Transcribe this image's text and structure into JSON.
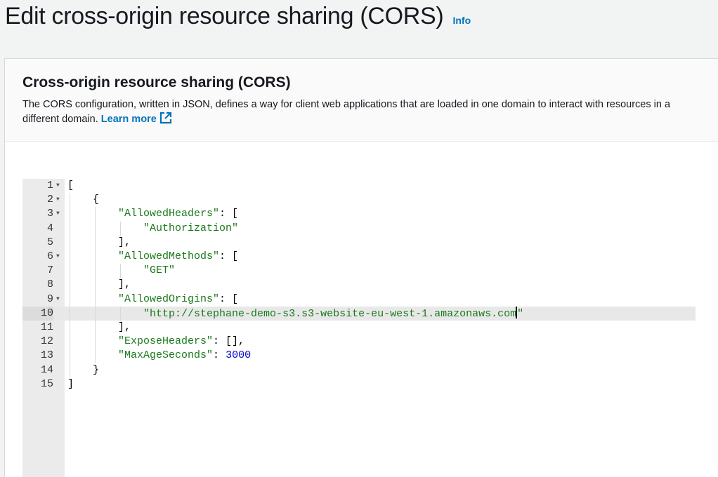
{
  "page": {
    "title": "Edit cross-origin resource sharing (CORS)",
    "info_label": "Info"
  },
  "panel": {
    "title": "Cross-origin resource sharing (CORS)",
    "description": "The CORS configuration, written in JSON, defines a way for client web applications that are loaded in one domain to interact with resources in a different domain.",
    "learn_more": "Learn more"
  },
  "editor": {
    "active_line": 10,
    "line_numbers": [
      "1",
      "2",
      "3",
      "4",
      "5",
      "6",
      "7",
      "8",
      "9",
      "10",
      "11",
      "12",
      "13",
      "14",
      "15"
    ],
    "lines": [
      {
        "indent": "",
        "tokens": [
          {
            "t": "[",
            "c": "p"
          }
        ],
        "fold": true
      },
      {
        "indent": "    ",
        "tokens": [
          {
            "t": "{",
            "c": "p"
          }
        ],
        "fold": true
      },
      {
        "indent": "        ",
        "tokens": [
          {
            "t": "\"AllowedHeaders\"",
            "c": "s"
          },
          {
            "t": ": [",
            "c": "p"
          }
        ],
        "fold": true
      },
      {
        "indent": "            ",
        "tokens": [
          {
            "t": "\"Authorization\"",
            "c": "s"
          }
        ]
      },
      {
        "indent": "        ",
        "tokens": [
          {
            "t": "],",
            "c": "p"
          }
        ]
      },
      {
        "indent": "        ",
        "tokens": [
          {
            "t": "\"AllowedMethods\"",
            "c": "s"
          },
          {
            "t": ": [",
            "c": "p"
          }
        ],
        "fold": true
      },
      {
        "indent": "            ",
        "tokens": [
          {
            "t": "\"GET\"",
            "c": "s"
          }
        ]
      },
      {
        "indent": "        ",
        "tokens": [
          {
            "t": "],",
            "c": "p"
          }
        ]
      },
      {
        "indent": "        ",
        "tokens": [
          {
            "t": "\"AllowedOrigins\"",
            "c": "s"
          },
          {
            "t": ": [",
            "c": "p"
          }
        ],
        "fold": true
      },
      {
        "indent": "            ",
        "tokens": [
          {
            "t": "\"http://stephane-demo-s3.s3-website-eu-west-1.amazonaws.com",
            "c": "s"
          },
          {
            "t": "CURSOR",
            "c": "cursor"
          },
          {
            "t": "\"",
            "c": "s"
          }
        ]
      },
      {
        "indent": "        ",
        "tokens": [
          {
            "t": "],",
            "c": "p"
          }
        ]
      },
      {
        "indent": "        ",
        "tokens": [
          {
            "t": "\"ExposeHeaders\"",
            "c": "s"
          },
          {
            "t": ": [],",
            "c": "p"
          }
        ]
      },
      {
        "indent": "        ",
        "tokens": [
          {
            "t": "\"MaxAgeSeconds\"",
            "c": "s"
          },
          {
            "t": ": ",
            "c": "p"
          },
          {
            "t": "3000",
            "c": "n"
          }
        ]
      },
      {
        "indent": "    ",
        "tokens": [
          {
            "t": "}",
            "c": "p"
          }
        ]
      },
      {
        "indent": "",
        "tokens": [
          {
            "t": "]",
            "c": "p"
          }
        ]
      }
    ]
  },
  "colors": {
    "link": "#0073bb",
    "string": "#1a7a1a",
    "number": "#0000cd"
  },
  "icons": {
    "external_link": "external-link-icon",
    "fold_arrow": "fold-arrow-icon"
  }
}
